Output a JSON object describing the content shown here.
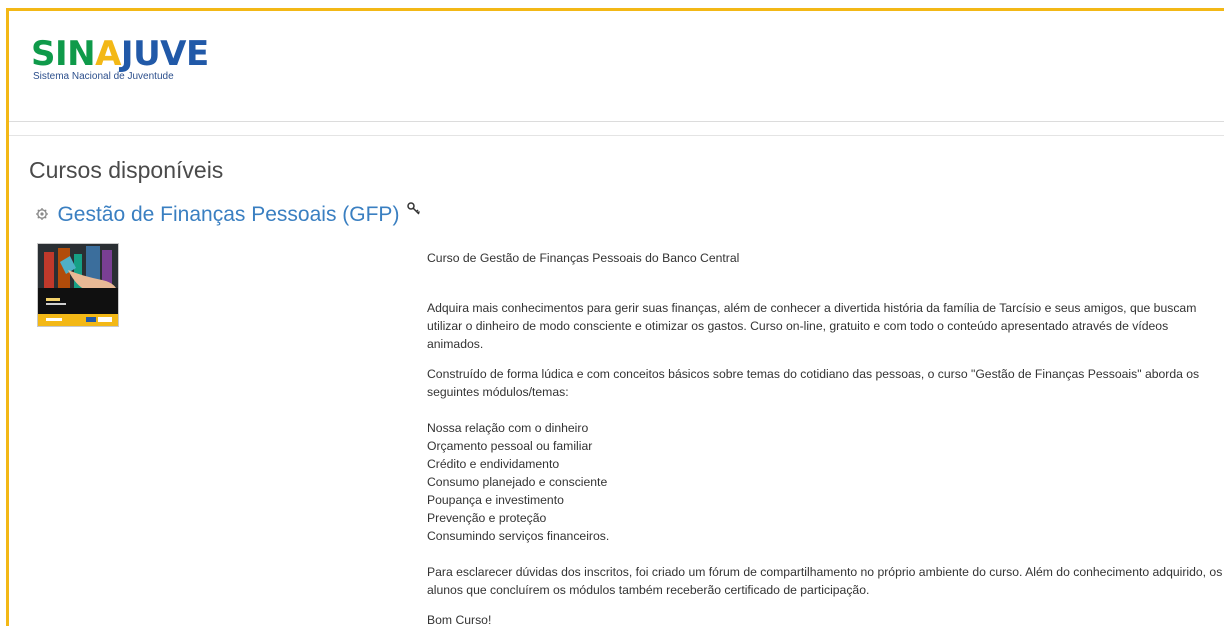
{
  "logo": {
    "word_part1": "SIN",
    "word_part2": "A",
    "word_part3": "JUVE",
    "subtitle": "Sistema Nacional de Juventude",
    "colors": {
      "green": "#0f9a4a",
      "yellow": "#f3b816",
      "blue": "#2159a8"
    }
  },
  "page": {
    "title": "Cursos disponíveis"
  },
  "course": {
    "title": "Gestão de Finanças Pessoais (GFP)",
    "icons": {
      "course": "course-icon",
      "enrol": "key-icon"
    },
    "intro": "Curso de Gestão de Finanças Pessoais do Banco Central",
    "para1": "Adquira mais conhecimentos para gerir suas finanças, além de conhecer a divertida história da família de Tarcísio e seus amigos, que buscam utilizar o dinheiro de modo consciente e otimizar os gastos. Curso on-line, gratuito e com todo o conteúdo apresentado através de vídeos animados.",
    "para2": "Construído de forma lúdica e com conceitos básicos sobre temas do cotidiano das pessoas, o curso \"Gestão de Finanças Pessoais\" aborda os seguintes módulos/temas:",
    "modules": [
      "Nossa relação com o dinheiro",
      "Orçamento pessoal ou familiar",
      "Crédito e endividamento",
      "Consumo planejado e consciente",
      "Poupança e investimento",
      "Prevenção e proteção",
      "Consumindo serviços financeiros."
    ],
    "para3": "Para esclarecer dúvidas dos inscritos, foi criado um fórum de compartilhamento no próprio ambiente do curso. Além do conhecimento adquirido, os alunos que concluírem os módulos também receberão certificado de participação.",
    "closing": "Bom Curso!"
  },
  "colors": {
    "accent_border": "#f3b816",
    "link": "#3a7fc1"
  }
}
